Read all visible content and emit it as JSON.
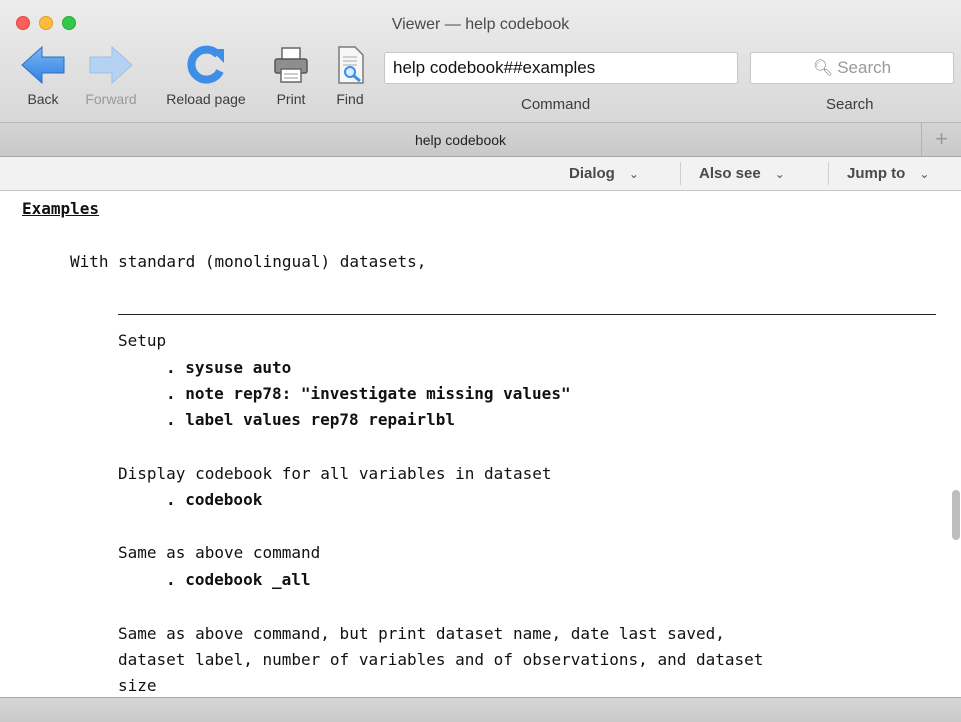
{
  "window": {
    "title": "Viewer — help codebook"
  },
  "toolbar": {
    "back_label": "Back",
    "forward_label": "Forward",
    "reload_label": "Reload page",
    "print_label": "Print",
    "find_label": "Find",
    "command_value": "help codebook##examples",
    "command_label": "Command",
    "search_placeholder": "Search",
    "search_label": "Search"
  },
  "tabs": [
    {
      "label": "help codebook"
    }
  ],
  "tab_add": "+",
  "menus": {
    "dialog": "Dialog",
    "also_see": "Also see",
    "jump_to": "Jump to"
  },
  "content": {
    "heading": "Examples",
    "intro": "With standard (monolingual) datasets,",
    "setup_label": "Setup",
    "cmd1": ". sysuse auto",
    "cmd2": ". note rep78: \"investigate missing values\"",
    "cmd3": ". label values rep78 repairlbl",
    "desc1": "Display codebook for all variables in dataset",
    "cmd4": ". codebook",
    "desc2": "Same as above command",
    "cmd5": ". codebook _all",
    "desc3_line1": "Same as above command, but print dataset name, date last saved,",
    "desc3_line2": "dataset label, number of variables and of observations, and dataset",
    "desc3_line3": "size"
  },
  "icons": {
    "back": "back-arrow-icon",
    "forward": "forward-arrow-icon",
    "reload": "reload-icon",
    "print": "printer-icon",
    "find": "find-document-icon"
  },
  "colors": {
    "icon_blue": "#3f8ee6",
    "icon_disabled": "#a9c8ee"
  }
}
